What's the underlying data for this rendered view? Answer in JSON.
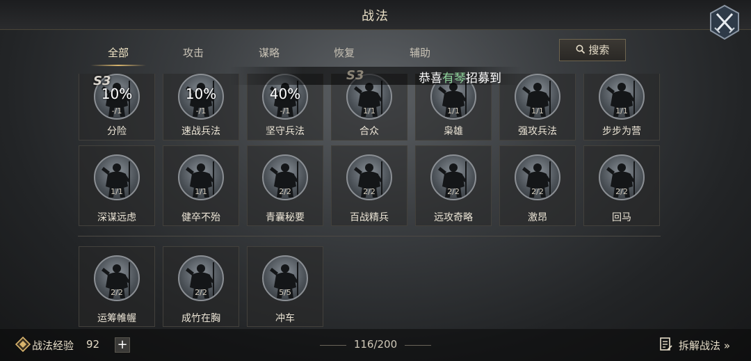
{
  "header": {
    "title": "战法"
  },
  "tabs": [
    {
      "label": "全部",
      "active": true
    },
    {
      "label": "攻击",
      "active": false
    },
    {
      "label": "谋略",
      "active": false
    },
    {
      "label": "恢复",
      "active": false
    },
    {
      "label": "辅助",
      "active": false
    }
  ],
  "search": {
    "label": "搜索"
  },
  "notice": {
    "prefix": "恭喜",
    "highlight": "有琴",
    "suffix": "招募到",
    "season": "S3"
  },
  "cards": [
    {
      "name": "分险",
      "count": "-/1",
      "percent": "10%",
      "season": "S3"
    },
    {
      "name": "速战兵法",
      "count": "-/1",
      "percent": "10%"
    },
    {
      "name": "坚守兵法",
      "count": "-/1",
      "percent": "40%"
    },
    {
      "name": "合众",
      "count": "1/1"
    },
    {
      "name": "枭雄",
      "count": "1/1"
    },
    {
      "name": "强攻兵法",
      "count": "1/1"
    },
    {
      "name": "步步为营",
      "count": "1/1"
    },
    {
      "name": "深谋远虑",
      "count": "1/1"
    },
    {
      "name": "健卒不殆",
      "count": "1/1"
    },
    {
      "name": "青囊秘要",
      "count": "2/2"
    },
    {
      "name": "百战精兵",
      "count": "2/2"
    },
    {
      "name": "远攻奇略",
      "count": "2/2"
    },
    {
      "name": "激昂",
      "count": "2/2"
    },
    {
      "name": "回马",
      "count": "2/2"
    },
    {
      "name": "运筹帷幄",
      "count": "2/2"
    },
    {
      "name": "成竹在胸",
      "count": "2/2"
    },
    {
      "name": "冲车",
      "count": "5/5"
    }
  ],
  "footer": {
    "exp_label": "战法经验",
    "exp_value": "92",
    "plus": "+",
    "capacity": "116/200",
    "dismantle": "拆解战法 »"
  },
  "colors": {
    "accent": "#d9b56d",
    "highlight": "#8fd49b"
  }
}
